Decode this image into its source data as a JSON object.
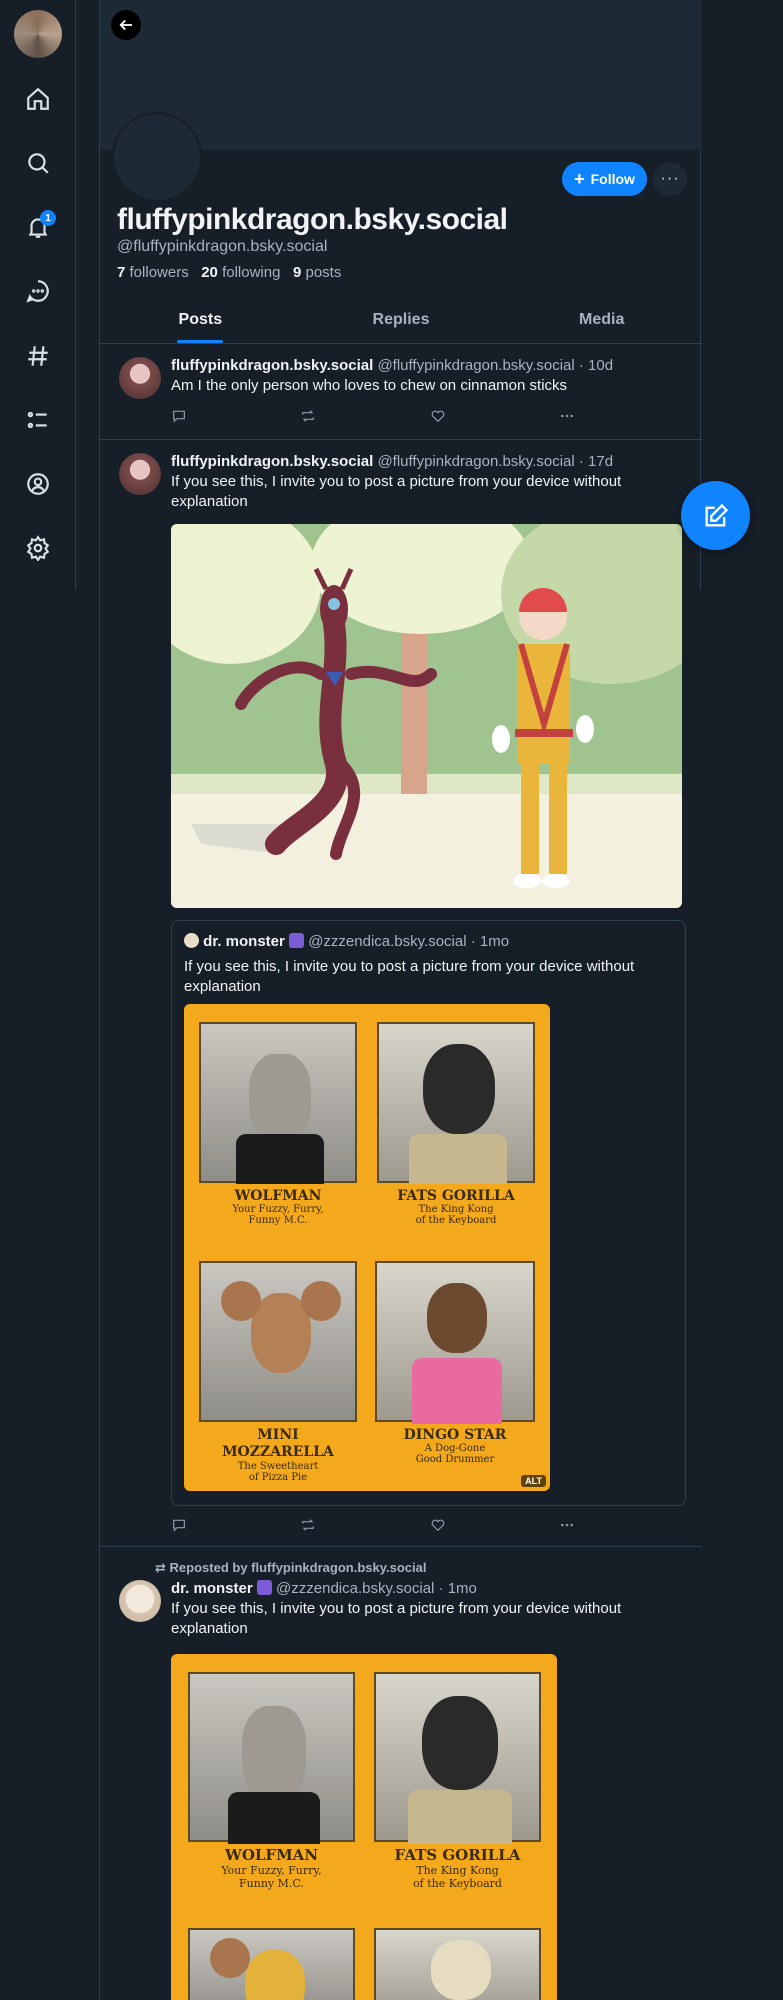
{
  "profile": {
    "display_name": "fluffypinkdragon.bsky.social",
    "handle": "@fluffypinkdragon.bsky.social",
    "followers_count": "7",
    "followers_label": "followers",
    "following_count": "20",
    "following_label": "following",
    "posts_count": "9",
    "posts_label": "posts",
    "follow_label": "Follow",
    "more_label": "···"
  },
  "nav": {
    "notification_badge": "1",
    "items": [
      "home-icon",
      "search-icon",
      "bell-icon",
      "chat-icon",
      "hashtag-icon",
      "list-icon",
      "profile-icon",
      "settings-icon"
    ]
  },
  "tabs": [
    {
      "label": "Posts",
      "active": true
    },
    {
      "label": "Replies",
      "active": false
    },
    {
      "label": "Media",
      "active": false
    }
  ],
  "posts": [
    {
      "author": "fluffypinkdragon.bsky.social",
      "handle": "@fluffypinkdragon.bsky.social",
      "time": "· 10d",
      "text": "Am I the only person who loves to chew on cinnamon sticks"
    },
    {
      "author": "fluffypinkdragon.bsky.social",
      "handle": "@fluffypinkdragon.bsky.social",
      "time": "· 17d",
      "text": "If you see this, I invite you to post a picture from your device without explanation",
      "quote": {
        "author": "dr. monster",
        "handle": "@zzzendica.bsky.social",
        "time": "· 1mo",
        "text": "If you see this, I invite you to post a picture from your device without explanation",
        "alt_badge": "ALT",
        "poster": {
          "cells": [
            {
              "name": "WOLFMAN",
              "line1": "Your Fuzzy, Furry,",
              "line2": "Funny M.C."
            },
            {
              "name": "FATS GORILLA",
              "line1": "The King Kong",
              "line2": "of the Keyboard"
            },
            {
              "name": "MINI",
              "name2": "MOZZARELLA",
              "line1": "The Sweetheart",
              "line2": "of Pizza Pie"
            },
            {
              "name": "DINGO STAR",
              "line1": "A Dog-Gone",
              "line2": "Good Drummer"
            }
          ]
        }
      }
    },
    {
      "repost_label": "Reposted by fluffypinkdragon.bsky.social",
      "author": "dr. monster",
      "handle": "@zzzendica.bsky.social",
      "time": "· 1mo",
      "text": "If you see this, I invite you to post a picture from your device without explanation",
      "poster": {
        "cells": [
          {
            "name": "WOLFMAN",
            "line1": "Your Fuzzy, Furry,",
            "line2": "Funny M.C."
          },
          {
            "name": "FATS GORILLA",
            "line1": "The King Kong",
            "line2": "of the Keyboard"
          }
        ]
      }
    }
  ]
}
